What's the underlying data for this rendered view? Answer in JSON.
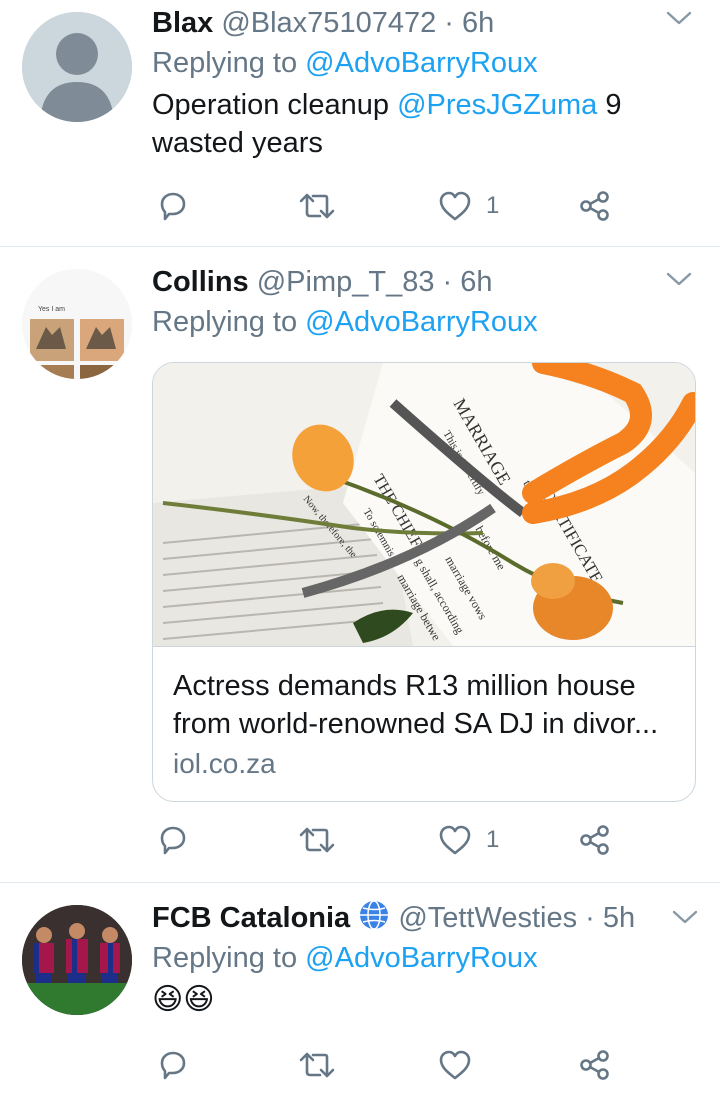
{
  "tweets": [
    {
      "name": "Blax",
      "handle": "@Blax75107472",
      "time": "6h",
      "replying_prefix": "Replying to",
      "replying_to": "@AdvoBarryRoux",
      "text_before": "Operation cleanup ",
      "text_mention": "@PresJGZuma",
      "text_after": " 9 wasted years",
      "likes": "1"
    },
    {
      "name": "Collins",
      "handle": "@Pimp_T_83",
      "time": "6h",
      "replying_prefix": "Replying to",
      "replying_to": "@AdvoBarryRoux",
      "card": {
        "title_line1": "Actress demands R13 million house",
        "title_line2": "from world-renowned SA DJ in divor...",
        "domain": "iol.co.za",
        "image_text": [
          "MARRIAGE",
          "CERTIFICATE",
          "This is to certify",
          "THE CHIEF",
          "To solemnis",
          "Now, therefore, the",
          "before me",
          "that the",
          "marriage vows",
          "g shall, according",
          "marriage betwe"
        ]
      },
      "avatar_text": "Yes I am",
      "likes": "1"
    },
    {
      "name": "FCB Catalonia",
      "handle": "@TettWesties",
      "time": "5h",
      "replying_prefix": "Replying to",
      "replying_to": "@AdvoBarryRoux",
      "text": "😆😆",
      "verified_icon": "globe-icon"
    }
  ],
  "colors": {
    "link": "#1da1f2",
    "secondary": "#657786",
    "divider": "#e1e8ed"
  },
  "separator": "·"
}
